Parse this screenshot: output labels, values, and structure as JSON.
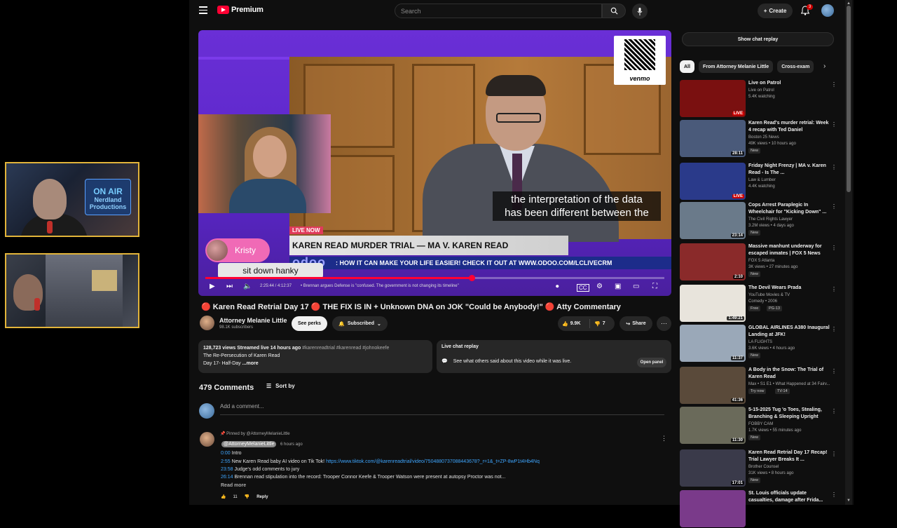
{
  "overlay": {
    "cam1_sign_line1": "ON AIR",
    "cam1_sign_line2": "Nerdland Productions"
  },
  "masthead": {
    "logo_text": "Premium",
    "search_placeholder": "Search",
    "create_label": "Create",
    "notifications_count": "3"
  },
  "player": {
    "qr_label": "venmo",
    "caption_line1": "the interpretation of the data",
    "caption_line2": "has been different between the",
    "live_now": "LIVE NOW",
    "lower_third": "KAREN READ MURDER TRIAL — MA V. KAREN READ",
    "ticker_logo": "odoo",
    "ticker_text": ": HOW IT CAN MAKE YOUR LIFE EASIER! CHECK IT OUT AT WWW.ODOO.COM/LCLIVECRM",
    "chat_name": "Kristy",
    "chat_message": "sit down hanky",
    "time": "2:25:44 / 4:12:37",
    "chapter": "• Brennan argues Defense is \"confused. The government is not changing its timeline\"",
    "progress": 0.58
  },
  "video": {
    "title_prefix": "🔴",
    "title": "Karen Read Retrial Day 17 🔴 THE FIX IS IN + Unknown DNA on JOK \"Could be Anybody!\" 🔴 Atty Commentary",
    "channel": "Attorney Melanie Little",
    "subscribers": "98.1K subscribers",
    "perks": "See perks",
    "subscribed": "Subscribed",
    "likes": "9.9K",
    "comments_count_btn": "7",
    "share": "Share"
  },
  "description": {
    "stats": "128,723 views  Streamed live 14 hours ago",
    "tags": "#karenreadtrial #karenread #johnokeefe",
    "line2": "The Re-Persecution of Karen Read",
    "line3": "Day 17- Half-Day",
    "more": "...more"
  },
  "livechat": {
    "heading": "Live chat replay",
    "text": "See what others said about this video while it was live.",
    "button": "Open panel"
  },
  "comments": {
    "count": "479 Comments",
    "sort": "Sort by",
    "add_placeholder": "Add a comment...",
    "pinned_by": "Pinned by @AttorneyMelanieLittle",
    "author": "@AttorneyMelanieLittle",
    "time": "6 hours ago",
    "lines": [
      {
        "ts": "0:00",
        "text": " Intro",
        "link": ""
      },
      {
        "ts": "2:55",
        "text": " New Karen Read baby AI video on Tik Tok! ",
        "link": "https://www.tiktok.com/@karenreadtrial/video/7504880737088443678?_r=1&_t=ZP-8wP1t4Hb4Nq"
      },
      {
        "ts": "23:58",
        "text": " Judge's odd comments to jury",
        "link": ""
      },
      {
        "ts": "26:14",
        "text": " Brennan read stipulation into the record: Trooper Connor Keefe & Trooper Watson were present at autopsy  Proctor was not...",
        "link": ""
      }
    ],
    "read_more": "Read more",
    "likes": "11",
    "reply": "Reply"
  },
  "sidebar": {
    "chat_replay": "Show chat replay",
    "chips": [
      "All",
      "From Attorney Melanie Little",
      "Cross-exam"
    ],
    "recs": [
      {
        "title": "Live on Patrol",
        "channel": "Live on Patrol",
        "meta": "5.4K watching",
        "dur": "LIVE",
        "live": true,
        "badge": "",
        "badge2": "",
        "thumb": "#7a1010"
      },
      {
        "title": "Karen Read's murder retrial: Week 4 recap with Ted Daniel",
        "channel": "Boston 25 News",
        "meta": "49K views • 10 hours ago",
        "dur": "28:11",
        "live": false,
        "badge": "New",
        "badge2": "",
        "thumb": "#4a5a7a"
      },
      {
        "title": "Friday Night Frenzy | MA v. Karen Read - Is The ...",
        "channel": "Law & Lumber",
        "meta": "4.4K watching",
        "dur": "LIVE",
        "live": true,
        "badge": "",
        "badge2": "",
        "thumb": "#2a3a8a"
      },
      {
        "title": "Cops Arrest Paraplegic In Wheelchair for \"Kicking Down\" ...",
        "channel": "The Civil Rights Lawyer",
        "meta": "3.2M views • 4 days ago",
        "dur": "23:14",
        "live": false,
        "badge": "New",
        "badge2": "",
        "thumb": "#6a7a8a"
      },
      {
        "title": "Massive manhunt underway for escaped inmates | FOX 5 News",
        "channel": "FOX 5 Atlanta",
        "meta": "3K views • 27 minutes ago",
        "dur": "2:10",
        "live": false,
        "badge": "New",
        "badge2": "",
        "thumb": "#8a2a2a"
      },
      {
        "title": "The Devil Wears Prada",
        "channel": "YouTube Movies & TV",
        "meta": "Comedy • 2006",
        "dur": "1:49:21",
        "live": false,
        "badge": "Free",
        "badge2": "PG-13",
        "thumb": "#e8e4dc"
      },
      {
        "title": "GLOBAL AIRLINES A380 Inaugural Landing at JFK!",
        "channel": "LA FLIGHTS",
        "meta": "3.6K views • 4 hours ago",
        "dur": "11:37",
        "live": false,
        "badge": "New",
        "badge2": "",
        "thumb": "#9aa8b8"
      },
      {
        "title": "A Body in the Snow: The Trial of Karen Read",
        "channel": "Max • S1 E1 • What Happened at 34 Fairv...",
        "meta": "",
        "dur": "41:36",
        "live": false,
        "badge": "Try now",
        "badge2": "TV-14",
        "thumb": "#5a4a3a"
      },
      {
        "title": "5-15-2025 Tug 'o Toes, Stealing, Branching & Sleeping Upright",
        "channel": "FOBBY CAM",
        "meta": "1.7K views • 55 minutes ago",
        "dur": "11:30",
        "live": false,
        "badge": "New",
        "badge2": "",
        "thumb": "#6a6a5a"
      },
      {
        "title": "Karen Read Retrial Day 17 Recap! Trial Lawyer Breaks It ...",
        "channel": "Brother Counsel",
        "meta": "31K views • 8 hours ago",
        "dur": "17:01",
        "live": false,
        "badge": "New",
        "badge2": "",
        "thumb": "#3a3a4a"
      },
      {
        "title": "St. Louis officials update casualties, damage after Frida...",
        "channel": "",
        "meta": "",
        "dur": "",
        "live": false,
        "badge": "",
        "badge2": "",
        "thumb": "#7a3a8a"
      }
    ]
  },
  "colors": {
    "accent": "#ff0033",
    "player_purple": "#6a2fd6",
    "link": "#3ea6ff"
  }
}
